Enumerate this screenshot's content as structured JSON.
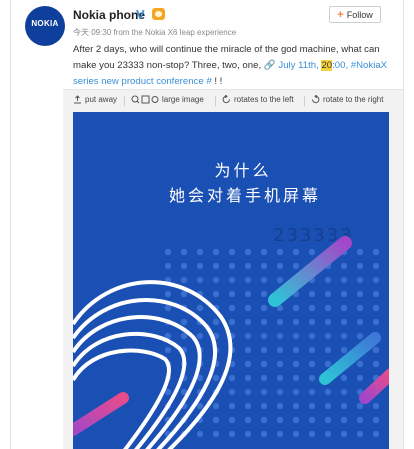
{
  "post": {
    "author": "Nokia phone",
    "verified_mark": "V",
    "avatar_text": "NOKIA",
    "meta": "今天 09:30 from the Nokia X6 leap experience",
    "follow_label": "Follow",
    "follow_plus": "+",
    "text_part1": "After 2 days, who will continue the miracle of the god machine, what can make",
    "text_part2": "you 23333 non-stop? Three, two, one,",
    "link_icon": "🔗",
    "date_link_a": "July 11th,",
    "date_highlight": "20",
    "date_link_b": ":00,",
    "hashtag_a": "#NokiaX series",
    "hashtag_b": "new product conference #",
    "text_end": "! !"
  },
  "toolbar": {
    "put_away": "put away",
    "large_image": "large image",
    "rotate_left": "rotates to the left",
    "rotate_right": "rotate to the right"
  },
  "poster": {
    "line1": "为什么",
    "line2": "她会对着手机屏幕",
    "number": "233333",
    "background_color": "#1a4fb3",
    "accent_colors": [
      "#2ec4d6",
      "#a347c8",
      "#e84c8a"
    ]
  }
}
